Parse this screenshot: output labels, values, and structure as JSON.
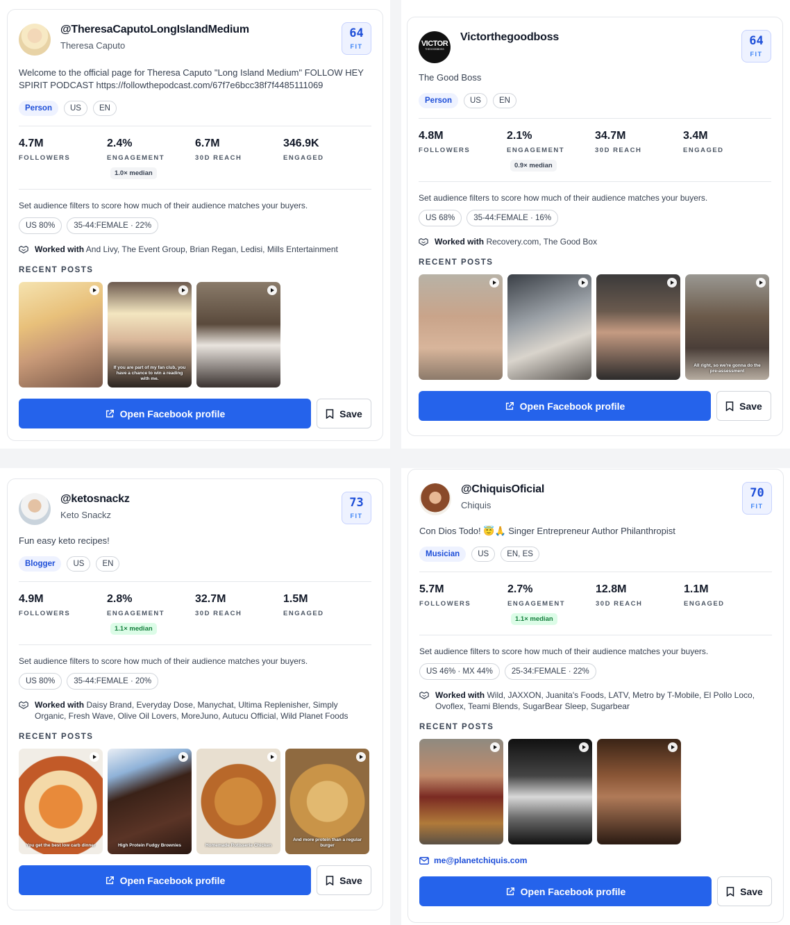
{
  "common": {
    "fit_label": "FIT",
    "followers_label": "FOLLOWERS",
    "engagement_label": "ENGAGEMENT",
    "reach_label": "30D REACH",
    "engaged_label": "ENGAGED",
    "audience_hint": "Set audience filters to score how much of their audience matches your buyers.",
    "worked_label": "Worked with",
    "recent_posts_label": "RECENT POSTS",
    "open_label": "Open Facebook profile",
    "save_label": "Save"
  },
  "cards": [
    {
      "handle": "@TheresaCaputoLongIslandMedium",
      "name": "Theresa Caputo",
      "fit": "64",
      "bio": "Welcome to the official page for Theresa Caputo \"Long Island Medium\" FOLLOW HEY SPIRIT PODCAST https://followthepodcast.com/67f7e6bcc38f7f4485111069",
      "category": "Person",
      "country": "US",
      "language": "EN",
      "followers": "4.7M",
      "engagement": "2.4%",
      "median": "1.0× median",
      "reach": "6.7M",
      "engaged": "346.9K",
      "audience": [
        "US 80%",
        "35-44:FEMALE · 22%"
      ],
      "worked_with": "And Livy, The Event Group, Brian Regan, Ledisi, Mills Entertainment",
      "posts": [
        {
          "caption": ""
        },
        {
          "caption": "If you are part of my fan club, you have a chance to win a reading with me."
        },
        {
          "caption": ""
        }
      ]
    },
    {
      "handle": "Victorthegoodboss",
      "name": "",
      "avatar_text": "VICTOR",
      "avatar_subtext": "THEGOODBOSS",
      "fit": "64",
      "bio": "The Good Boss",
      "category": "Person",
      "country": "US",
      "language": "EN",
      "followers": "4.8M",
      "engagement": "2.1%",
      "median": "0.9× median",
      "reach": "34.7M",
      "engaged": "3.4M",
      "audience": [
        "US 68%",
        "35-44:FEMALE · 16%"
      ],
      "worked_with": "Recovery.com, The Good Box",
      "posts": [
        {
          "caption": ""
        },
        {
          "caption": ""
        },
        {
          "caption": ""
        },
        {
          "caption": "All right, so we're gonna do the pre-assessment"
        }
      ]
    },
    {
      "handle": "@ketosnackz",
      "name": "Keto Snackz",
      "fit": "73",
      "bio": "Fun easy keto recipes!",
      "category": "Blogger",
      "country": "US",
      "language": "EN",
      "followers": "4.9M",
      "engagement": "2.8%",
      "median": "1.1× median",
      "reach": "32.7M",
      "engaged": "1.5M",
      "audience": [
        "US 80%",
        "35-44:FEMALE · 20%"
      ],
      "worked_with": "Daisy Brand, Everyday Dose, Manychat, Ultima Replenisher, Simply Organic, Fresh Wave, Olive Oil Lovers, MoreJuno, Autucu Official, Wild Planet Foods",
      "posts": [
        {
          "caption": "You get the best low carb dinner"
        },
        {
          "caption": "High Protein Fudgy Brownies"
        },
        {
          "caption": "Homemade Rotisserie Chicken"
        },
        {
          "caption": "And more protein than a regular burger"
        }
      ]
    },
    {
      "handle": "@ChiquisOficial",
      "name": "Chiquis",
      "fit": "70",
      "bio": "Con Dios Todo! 😇🙏 Singer Entrepreneur Author Philanthropist",
      "category": "Musician",
      "country": "US",
      "language": "EN, ES",
      "followers": "5.7M",
      "engagement": "2.7%",
      "median": "1.1× median",
      "reach": "12.8M",
      "engaged": "1.1M",
      "audience": [
        "US 46% · MX 44%",
        "25-34:FEMALE · 22%"
      ],
      "worked_with": "Wild, JAXXON, Juanita's Foods, LATV, Metro by T-Mobile, El Pollo Loco, Ovoflex, Teami Blends, SugarBear Sleep, Sugarbear",
      "email": "me@planetchiquis.com",
      "posts": [
        {
          "caption": ""
        },
        {
          "caption": ""
        },
        {
          "caption": ""
        }
      ]
    }
  ]
}
